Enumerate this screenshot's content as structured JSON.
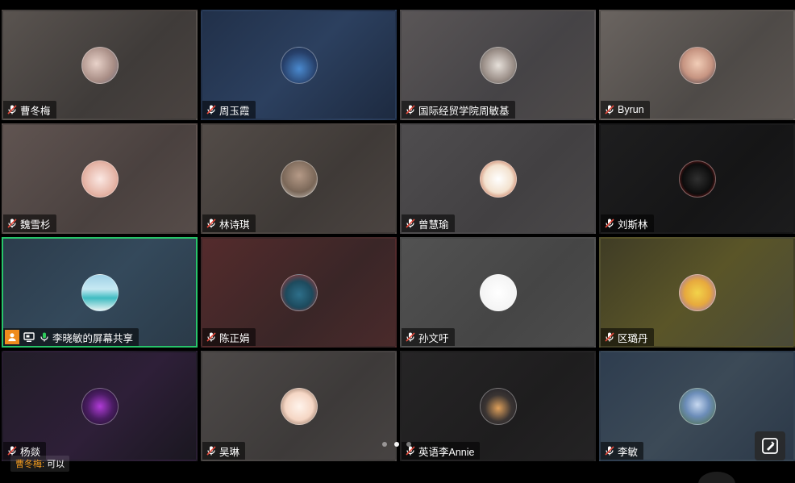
{
  "participants": [
    {
      "name": "曹冬梅",
      "bg": "linear-gradient(135deg,#5a5450,#3f3b39 60%,#4a4340)",
      "avatar": "radial-gradient(circle at 40% 45%,#e8d2c9,#a88d85 60%,#6b6a7a)",
      "icon": "mic-muted-icon"
    },
    {
      "name": "周玉霞",
      "bg": "linear-gradient(135deg,#213049,#2c405f 50%,#1d2a40)",
      "avatar": "radial-gradient(circle at 50% 60%,#4a8ad0,#27406a 60%,#1b2b48)",
      "icon": "mic-muted-icon"
    },
    {
      "name": "国际经贸学院周敏基",
      "bg": "linear-gradient(135deg,#5a5657,#454346 60%,#4f4b4a)",
      "avatar": "radial-gradient(circle at 50% 50%,#e6e0da,#9b8f88 60%,#555)",
      "icon": "mic-muted-icon"
    },
    {
      "name": "Byrun",
      "bg": "linear-gradient(135deg,#6a6460,#4e4a47 60%,#5c5652)",
      "avatar": "radial-gradient(circle at 50% 45%,#f1cdb7,#c69481 55%,#3e3a44)",
      "icon": "mic-muted-icon"
    },
    {
      "name": "魏雪杉",
      "bg": "linear-gradient(135deg,#605451,#4a413f 60%,#564c49)",
      "avatar": "radial-gradient(circle at 50% 50%,#fbe8e3,#e6b7a9 60%,#c9897a)",
      "icon": "mic-muted-icon"
    },
    {
      "name": "林诗琪",
      "bg": "linear-gradient(135deg,#534c48,#3f3a37 60%,#4b4441)",
      "avatar": "radial-gradient(circle at 50% 40%,#b59a87,#7a6758 60%,#c8c3bd)",
      "icon": "mic-muted-icon"
    },
    {
      "name": "曾慧瑜",
      "bg": "linear-gradient(135deg,#4f4d4f,#424042 60%,#4a4849)",
      "avatar": "radial-gradient(circle at 50% 50%,#ffffff,#f3e2cf 55%,#b04020)",
      "icon": "mic-muted-icon"
    },
    {
      "name": "刘斯林",
      "bg": "linear-gradient(135deg,#1e1e1f,#151516 60%,#1c1c1d)",
      "avatar": "radial-gradient(circle at 50% 50%,#303030,#0c0c0c 60%,#c02020)",
      "icon": "mic-muted-icon"
    },
    {
      "name": "李晓敏的屏幕共享",
      "bg": "linear-gradient(135deg,#2c3c4c,#34495b 50%,#2a3a48)",
      "avatar": "linear-gradient(180deg,#9fd1e6 0%,#c7e9f3 40%,#3fbcc2 65%,#e5f2f2 100%)",
      "icon": "mic-active-icon",
      "active": true
    },
    {
      "name": "陈正娟",
      "bg": "linear-gradient(135deg,#542b2c,#3a2627 60%,#4a2a2b)",
      "avatar": "radial-gradient(circle at 50% 55%,#2e6f8a,#1d4a5d 50%,#c0302c)",
      "icon": "mic-muted-icon"
    },
    {
      "name": "孙文吁",
      "bg": "linear-gradient(135deg,#525252,#454545 60%,#4d4d4d)",
      "avatar": "radial-gradient(circle at 50% 50%,#ffffff,#f4f4f4 70%,#cfcfcf)",
      "icon": "mic-muted-icon"
    },
    {
      "name": "区璐丹",
      "bg": "linear-gradient(135deg,#3f3c25,#5a5528 50%,#4a4a38)",
      "avatar": "radial-gradient(circle at 50% 50%,#f2d34a,#e7a93d 50%,#8b6bd3)",
      "icon": "mic-muted-icon"
    },
    {
      "name": "杨燚",
      "bg": "linear-gradient(135deg,#221d28,#2e1f38 55%,#1a1720)",
      "avatar": "radial-gradient(circle at 50% 50%,#b13bd8,#4b1d64 50%,#1a0f22)",
      "icon": "mic-muted-icon"
    },
    {
      "name": "吴琳",
      "bg": "linear-gradient(135deg,#4e4a49,#3d3a39 60%,#474342)",
      "avatar": "radial-gradient(circle at 50% 50%,#fff4ec,#f5d6c4 55%,#6b4b3a)",
      "icon": "mic-muted-icon"
    },
    {
      "name": "英语李Annie",
      "bg": "linear-gradient(135deg,#262526,#1e1d1e 60%,#242324)",
      "avatar": "radial-gradient(circle at 50% 55%,#e0a05a,#3b3533 50%,#1a1a22)",
      "icon": "mic-muted-icon"
    },
    {
      "name": "李敏",
      "bg": "linear-gradient(135deg,#2e3d4f,#3c4a57 50%,#2b3848)",
      "avatar": "radial-gradient(circle at 50% 45%,#c7d8f0,#6c8db9 45%,#4a6b3a)",
      "icon": "mic-muted-icon"
    }
  ],
  "chat": {
    "user": "曹冬梅:",
    "message": "可以"
  },
  "pager": {
    "count": 3,
    "current": 1
  },
  "ui": {
    "float_button_icon": "annotate-icon",
    "share_user_icon": "user-icon",
    "share_screen_icon": "screen-share-icon"
  }
}
